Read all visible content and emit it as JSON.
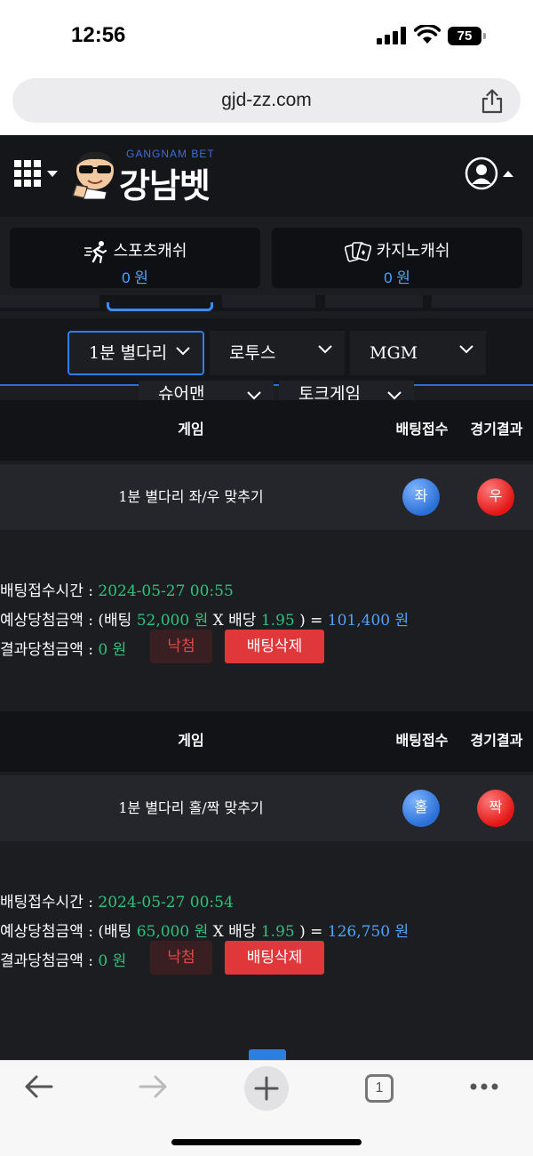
{
  "status": {
    "time": "12:56",
    "battery": "75"
  },
  "browser": {
    "url": "gjd-zz.com",
    "tab_count": "1"
  },
  "site": {
    "logo_sub": "GANGNAM BET",
    "logo_text": "강남벳",
    "wallets": [
      {
        "label": "스포츠캐쉬",
        "value": "0 원",
        "icon": "runner-icon"
      },
      {
        "label": "카지노캐쉬",
        "value": "0 원",
        "icon": "cards-icon"
      }
    ],
    "filters": [
      "1분 별다리",
      "로투스",
      "MGM"
    ],
    "filters_row2": [
      "슈어맨",
      "토크게임"
    ]
  },
  "table": {
    "col_game": "게임",
    "col_bet": "배팅접수",
    "col_result": "경기결과"
  },
  "labels": {
    "time": "배팅접수시간 : ",
    "expected": "예상당첨금액 : (배팅 ",
    "won": " 원",
    "x_odds": " X 배당 ",
    "equals": " ) = ",
    "result": "결과당첨금액 : "
  },
  "bets": [
    {
      "game": "1분 별다리 좌/우 맞추기",
      "bet_pick": "좌",
      "result_pick": "우",
      "time": "2024-05-27 00:55",
      "amount": "52,000",
      "odds": "1.95",
      "expected_win": "101,400 원",
      "result_win": "0 원",
      "status": "낙첨",
      "delete_label": "배팅삭제"
    },
    {
      "game": "1분 별다리 홀/짝 맞추기",
      "bet_pick": "홀",
      "result_pick": "짝",
      "time": "2024-05-27 00:54",
      "amount": "65,000",
      "odds": "1.95",
      "expected_win": "126,750 원",
      "result_win": "0 원",
      "status": "낙첨",
      "delete_label": "배팅삭제"
    }
  ],
  "colors": {
    "accent": "#2f7fe8",
    "win_green": "#2ec27e",
    "lose_red": "#e0383a"
  }
}
